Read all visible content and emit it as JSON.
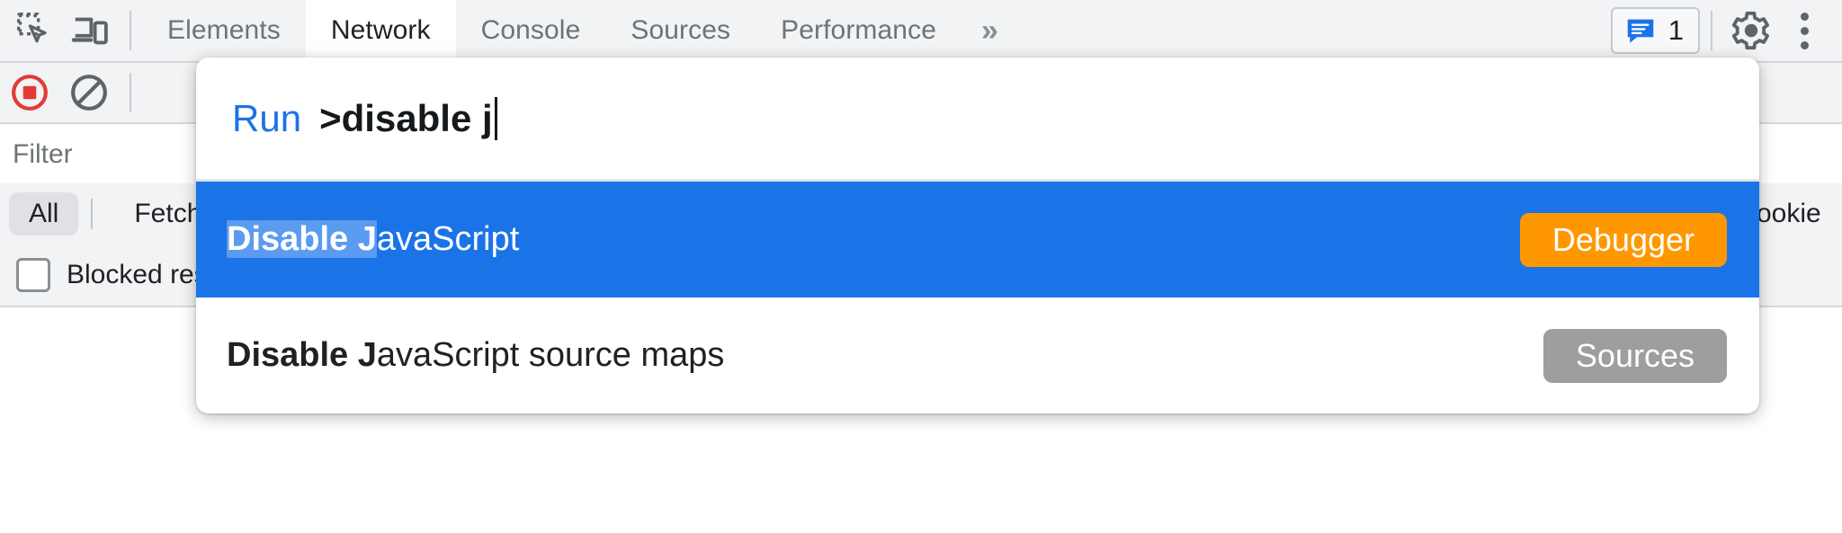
{
  "toolbar": {
    "inspect_icon": "inspect-element-icon",
    "device_icon": "device-toolbar-icon",
    "tabs": [
      {
        "label": "Elements",
        "selected": false
      },
      {
        "label": "Network",
        "selected": true
      },
      {
        "label": "Console",
        "selected": false
      },
      {
        "label": "Sources",
        "selected": false
      },
      {
        "label": "Performance",
        "selected": false
      }
    ],
    "more_tabs_label": "»",
    "message_badge": {
      "icon": "message-bubble-icon",
      "count": "1"
    },
    "settings_icon": "gear-icon",
    "menu_icon": "three-dot-menu-icon"
  },
  "network_panel": {
    "record_icon": "record-stop-icon",
    "clear_icon": "clear-network-log-icon",
    "filter_placeholder": "Filter",
    "type_chips": [
      {
        "label": "All",
        "active": true
      },
      {
        "label": "Fetch",
        "active": false
      }
    ],
    "blocked_checkbox": {
      "label": "Blocked response cookies",
      "checked": false
    },
    "right_cut_text": "ookie"
  },
  "command_palette": {
    "prefix_label": "Run",
    "query_bold": ">disable j",
    "results": [
      {
        "match_text": "Disable J",
        "rest_text": "avaScript",
        "tag": "Debugger",
        "tag_color": "#ff9800",
        "selected": true
      },
      {
        "match_text": "Disable J",
        "rest_text": "avaScript source maps",
        "tag": "Sources",
        "tag_color": "#9e9e9e",
        "selected": false
      }
    ]
  },
  "colors": {
    "accent_blue": "#1b73e8",
    "highlight_blue": "#5b9bf0",
    "toolbar_bg": "#f1f3f4",
    "record_red": "#e53935"
  }
}
